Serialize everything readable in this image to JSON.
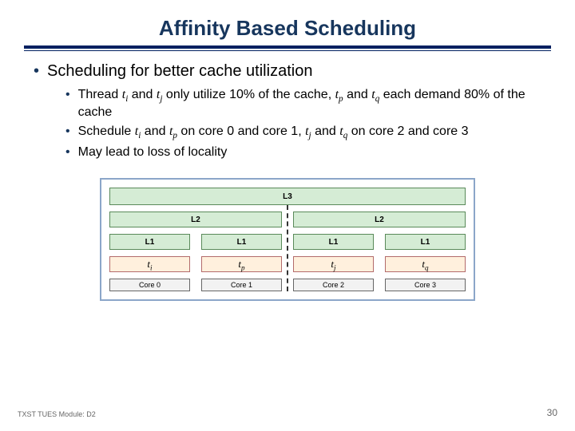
{
  "title": "Affinity Based Scheduling",
  "bullet1": "Scheduling for better cache utilization",
  "sub1a": "Thread ",
  "t_i": "t",
  "sub_i": "i",
  "sub1b": " and ",
  "t_j": "t",
  "sub_j": "j",
  "sub1c": " only utilize 10% of the cache, ",
  "t_p": "t",
  "sub_p": "p",
  "sub1d": " and ",
  "t_q": "t",
  "sub_q": "q",
  "sub1e": " each demand 80% of the cache",
  "sub2a": "Schedule ",
  "sub2b": " on core 0 and core 1, ",
  "sub2c": " on core 2 and core 3",
  "sub3": "May lead to loss of locality",
  "diagram": {
    "l3": "L3",
    "l2": "L2",
    "l1": "L1",
    "cores": [
      "Core 0",
      "Core 1",
      "Core 2",
      "Core 3"
    ],
    "threads": [
      {
        "base": "t",
        "sub": "i"
      },
      {
        "base": "t",
        "sub": "p"
      },
      {
        "base": "t",
        "sub": "j"
      },
      {
        "base": "t",
        "sub": "q"
      }
    ]
  },
  "footer": {
    "left": "TXST TUES Module: D2",
    "right": "30"
  }
}
